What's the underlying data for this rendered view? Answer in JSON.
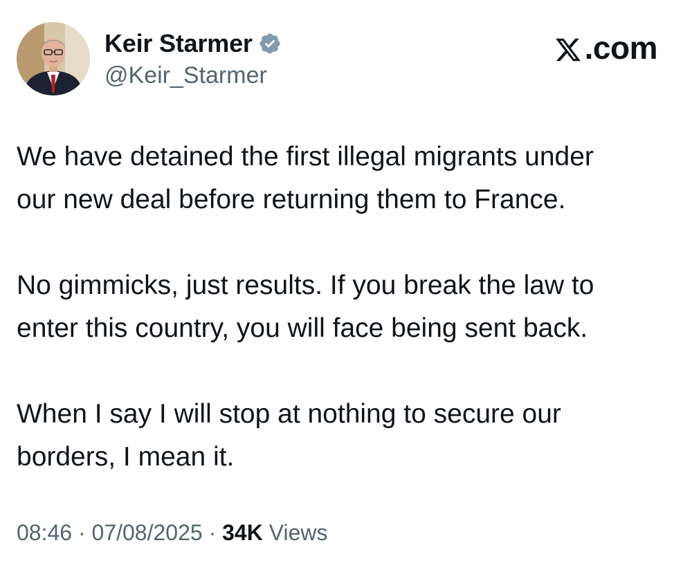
{
  "author": {
    "display_name": "Keir Starmer",
    "handle": "@Keir_Starmer",
    "verified_icon": "verified-badge-icon",
    "verified_color": "#829aab"
  },
  "brand": {
    "logo_icon": "x-logo-icon",
    "suffix": ".com"
  },
  "tweet": {
    "paragraphs": [
      "We have detained the first illegal migrants under\nour new deal before returning them to France.",
      "No gimmicks, just results. If you break the law to\nenter this country, you will face being sent back.",
      "When I say I will stop at nothing to secure our\nborders, I mean it."
    ]
  },
  "meta": {
    "time": "08:46",
    "separator": "·",
    "date": "07/08/2025",
    "views_count": "34K",
    "views_label": "Views"
  },
  "colors": {
    "text": "#0f1419",
    "secondary_text": "#536471",
    "background": "#ffffff"
  }
}
